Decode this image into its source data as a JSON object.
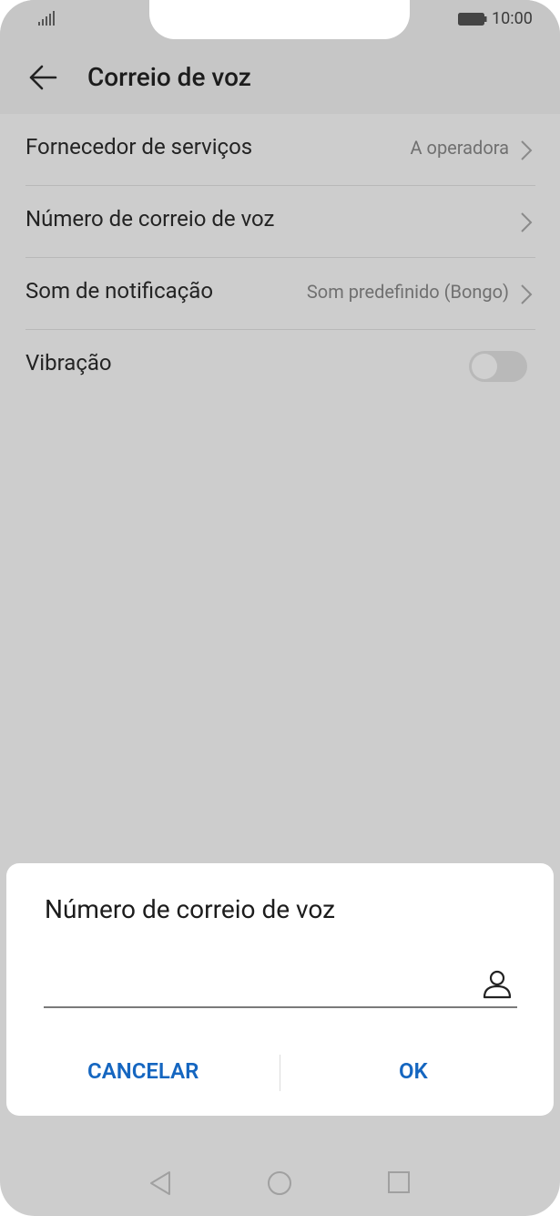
{
  "status_bar": {
    "time": "10:00"
  },
  "header": {
    "title": "Correio de voz"
  },
  "settings": [
    {
      "label": "Fornecedor de serviços",
      "value": "A operadora"
    },
    {
      "label": "Número de correio de voz",
      "value": ""
    },
    {
      "label": "Som de notificação",
      "value": "Som predefinido (Bongo)"
    },
    {
      "label": "Vibração",
      "toggle": false
    }
  ],
  "dialog": {
    "title": "Número de correio de voz",
    "input_value": "",
    "cancel_label": "CANCELAR",
    "ok_label": "OK"
  },
  "colors": {
    "accent": "#1566c0",
    "overlay": "#cdcdcd"
  },
  "icons": [
    "signal-icon",
    "battery-icon",
    "back-arrow-icon",
    "chevron-right-icon",
    "contact-icon",
    "nav-back-icon",
    "nav-home-icon",
    "nav-recents-icon"
  ]
}
